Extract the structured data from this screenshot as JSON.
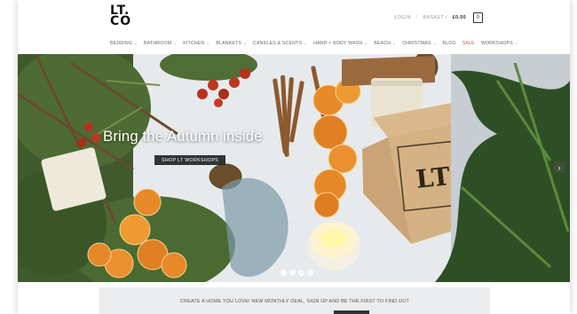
{
  "logo": {
    "line1": "LT.",
    "line2": "CO"
  },
  "account": {
    "login_label": "LOGIN",
    "separator": "|",
    "basket_label": "BASKET /",
    "basket_price": "£0.00",
    "cart_count": "0"
  },
  "nav": {
    "items": [
      {
        "label": "BEDDING",
        "has_dropdown": true
      },
      {
        "label": "BATHROOM",
        "has_dropdown": true
      },
      {
        "label": "KITCHEN",
        "has_dropdown": true
      },
      {
        "label": "BLANKETS",
        "has_dropdown": true
      },
      {
        "label": "CANDLES & SCENTS",
        "has_dropdown": true
      },
      {
        "label": "HAND + BODY WASH",
        "has_dropdown": true
      },
      {
        "label": "BEACH",
        "has_dropdown": true
      },
      {
        "label": "CHRISTMAS",
        "has_dropdown": true
      },
      {
        "label": "BLOG",
        "has_dropdown": false
      },
      {
        "label": "SALE",
        "has_dropdown": false
      },
      {
        "label": "WORKSHOPS",
        "has_dropdown": true
      }
    ],
    "dropdown_glyph": "⌄",
    "sale_color": "#c9593f"
  },
  "hero": {
    "title": "Bring the Autumn inside",
    "button_label": "SHOP LT WORKSHOPS",
    "next_arrow": "›",
    "slide_count": 4,
    "active_slide": 1,
    "box_logo": "LT"
  },
  "newsletter": {
    "text": "CREATE A HOME YOU LOVE! NEW MONTHLY DEAL, SIGN UP AND BE THE FIRST TO FIND OUT"
  },
  "colors": {
    "accent_sale": "#c9593f",
    "dark": "#222222"
  }
}
